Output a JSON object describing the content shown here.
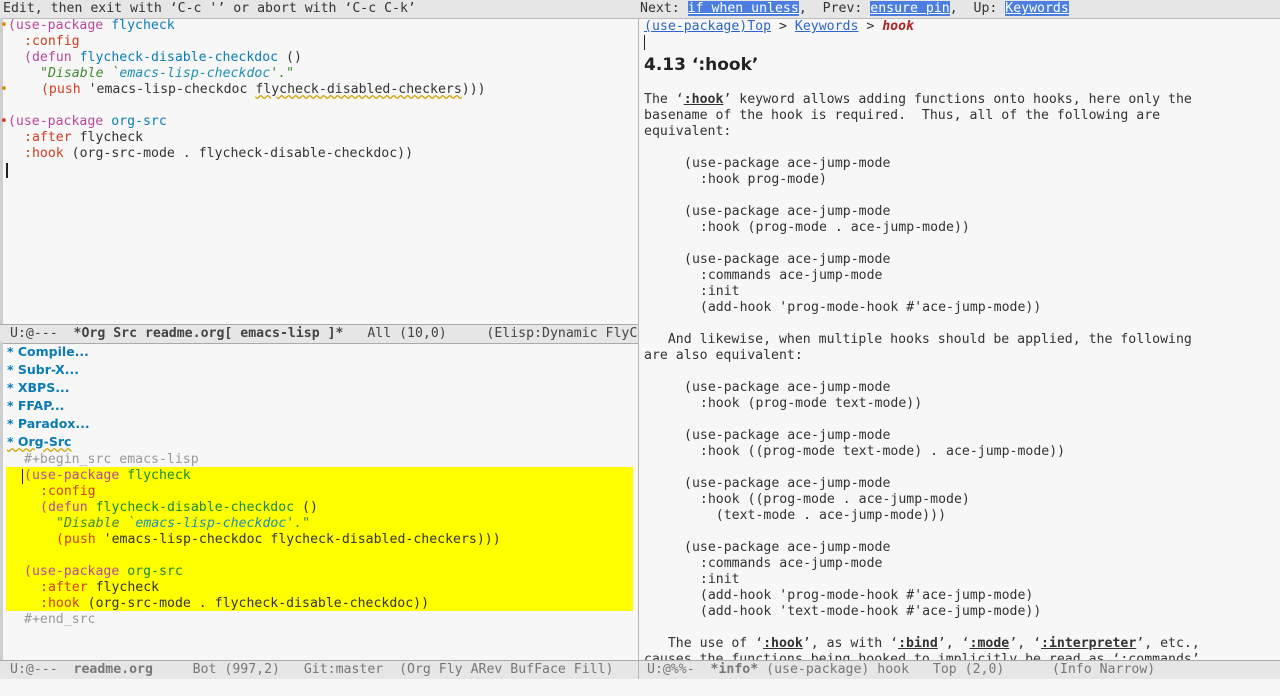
{
  "topbar": {
    "left": "Edit, then exit with ‘C-c '’ or abort with ‘C-c C-k’",
    "next_label": "Next:",
    "next_link": "if when unless",
    "prev_label": ",  Prev:",
    "prev_link": "ensure pin",
    "up_label": ",  Up:",
    "up_link": "Keywords"
  },
  "editor": {
    "l1_kw": "(use-package",
    "l1_pkg": "flycheck",
    "l2": ":config",
    "l3_a": "(defun",
    "l3_b": "flycheck-disable-checkdoc",
    "l3_c": "()",
    "l4_a": "\"Disable `",
    "l4_b": "emacs-lisp-checkdoc",
    "l4_c": "'.\"",
    "l5_a": "(push",
    "l5_b": "'emacs-lisp-checkdoc",
    "l5_c": "flycheck-disabled-checkers",
    "l5_d": ")))",
    "l7_kw": "(use-package",
    "l7_pkg": "org-src",
    "l8_a": ":after",
    "l8_b": "flycheck",
    "l9_a": ":hook",
    "l9_b": "(org-src-mode . flycheck-disable-checkdoc))"
  },
  "modeline_top": {
    "status": "U:@---",
    "buffer": "*Org Src readme.org[ emacs-lisp ]*",
    "pos": "All (10,0)",
    "modes": "(Elisp:Dynamic FlyC"
  },
  "org": {
    "headings": [
      "* Compile...",
      "* Subr-X...",
      "* XBPS...",
      "* FFAP...",
      "* Paradox...",
      "* Org-Src"
    ],
    "begin_src": "#+begin_src emacs-lisp",
    "end_src": "#+end_src"
  },
  "modeline_bottom_left": {
    "status": "U:@---",
    "buffer": "readme.org",
    "pos": "Bot (997,2)",
    "branch": "Git:master",
    "modes": "(Org Fly ARev BufFace Fill)"
  },
  "info": {
    "crumb_1": "(use-package)Top",
    "crumb_sep1": " > ",
    "crumb_2": "Keywords",
    "crumb_sep2": " > ",
    "crumb_3": "hook",
    "heading": "4.13 ‘:hook’",
    "p1_l1_a": "The ‘",
    "p1_l1_b": ":hook",
    "p1_l1_c": "’ keyword allows adding functions onto hooks, here only the",
    "p1_l2": "basename of the hook is required.  Thus, all of the following are",
    "p1_l3": "equivalent:",
    "ex1": [
      "(use-package ace-jump-mode",
      "  :hook prog-mode)"
    ],
    "ex2": [
      "(use-package ace-jump-mode",
      "  :hook (prog-mode . ace-jump-mode))"
    ],
    "ex3": [
      "(use-package ace-jump-mode",
      "  :commands ace-jump-mode",
      "  :init",
      "  (add-hook 'prog-mode-hook #'ace-jump-mode))"
    ],
    "p2_l1": "   And likewise, when multiple hooks should be applied, the following",
    "p2_l2": "are also equivalent:",
    "ex4": [
      "(use-package ace-jump-mode",
      "  :hook (prog-mode text-mode))"
    ],
    "ex5": [
      "(use-package ace-jump-mode",
      "  :hook ((prog-mode text-mode) . ace-jump-mode))"
    ],
    "ex6": [
      "(use-package ace-jump-mode",
      "  :hook ((prog-mode . ace-jump-mode)",
      "    (text-mode . ace-jump-mode)))"
    ],
    "ex7": [
      "(use-package ace-jump-mode",
      "  :commands ace-jump-mode",
      "  :init",
      "  (add-hook 'prog-mode-hook #'ace-jump-mode)",
      "  (add-hook 'text-mode-hook #'ace-jump-mode))"
    ],
    "p3_a": "   The use of ‘",
    "p3_b": ":hook",
    "p3_c": "’, as with ‘",
    "p3_d": ":bind",
    "p3_e": "’, ‘",
    "p3_f": ":mode",
    "p3_g": "’, ‘",
    "p3_h": ":interpreter",
    "p3_i": "’, etc.,",
    "p3_l2": "causes the functions being hooked to implicitly be read as ‘:commands’"
  },
  "modeline_info": {
    "status": "U:@%%-",
    "buffer": "*info*",
    "node": "(use-package) hook",
    "pos": "Top (2,0)",
    "modes": "(Info Narrow)"
  }
}
